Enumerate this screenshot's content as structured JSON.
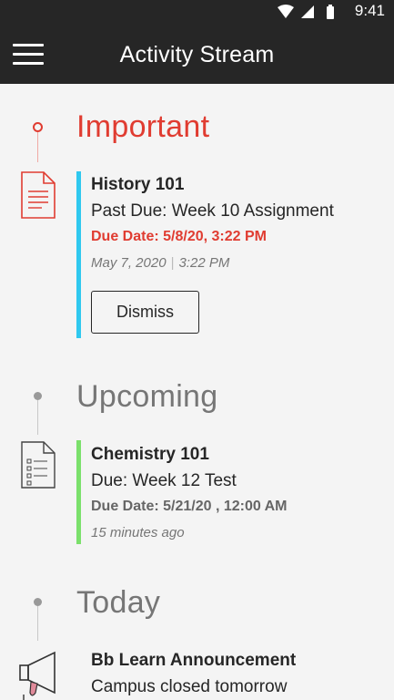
{
  "status_bar": {
    "time": "9:41",
    "icons": [
      "wifi-icon",
      "signal-icon",
      "battery-icon"
    ]
  },
  "app_bar": {
    "title": "Activity Stream",
    "menu_icon": "hamburger-menu-icon"
  },
  "colors": {
    "important": "#e03c31",
    "upcoming_bar": "#7be06b",
    "important_bar": "#2fc8ef",
    "muted_heading": "#767676",
    "app_bar": "#262626"
  },
  "sections": {
    "important": {
      "heading": "Important",
      "item": {
        "icon": "document-icon",
        "course": "History 101",
        "title": "Past Due: Week 10 Assignment",
        "due": "Due Date: 5/8/20, 3:22 PM",
        "date": "May 7, 2020",
        "separator": "|",
        "time": "3:22 PM",
        "dismiss_label": "Dismiss"
      }
    },
    "upcoming": {
      "heading": "Upcoming",
      "item": {
        "icon": "test-document-icon",
        "course": "Chemistry 101",
        "title": "Due: Week 12 Test",
        "due": "Due Date: 5/21/20 , 12:00 AM",
        "time_ago": "15 minutes ago"
      }
    },
    "today": {
      "heading": "Today",
      "item": {
        "icon": "megaphone-icon",
        "course": "Bb Learn Announcement",
        "title": "Campus closed tomorrow"
      }
    }
  }
}
